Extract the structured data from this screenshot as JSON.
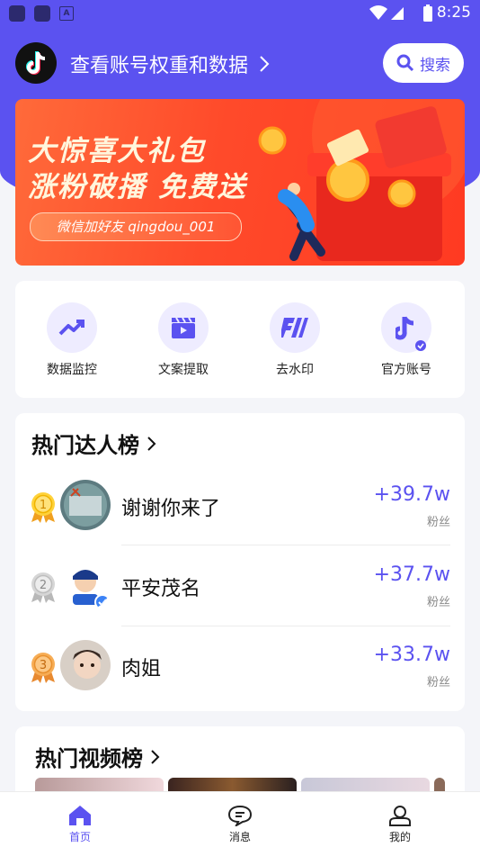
{
  "status_bar": {
    "time": "8:25"
  },
  "header": {
    "account_link": "查看账号权重和数据",
    "search_label": "搜索"
  },
  "banner": {
    "line1": "大惊喜大礼包",
    "line2": "涨粉破播 免费送",
    "wechat": "微信加好友 qingdou_001"
  },
  "tools": [
    {
      "label": "数据监控",
      "icon": "trend-up-icon"
    },
    {
      "label": "文案提取",
      "icon": "clapperboard-icon"
    },
    {
      "label": "去水印",
      "icon": "watermark-remove-icon"
    },
    {
      "label": "官方账号",
      "icon": "music-note-verified-icon"
    }
  ],
  "hot_creators": {
    "title": "热门达人榜",
    "items": [
      {
        "rank": "1",
        "name": "谢谢你来了",
        "gain": "+39.7w",
        "unit": "粉丝"
      },
      {
        "rank": "2",
        "name": "平安茂名",
        "gain": "+37.7w",
        "unit": "粉丝"
      },
      {
        "rank": "3",
        "name": "肉姐",
        "gain": "+33.7w",
        "unit": "粉丝"
      }
    ]
  },
  "hot_videos": {
    "title": "热门视频榜"
  },
  "tabbar": {
    "home": "首页",
    "messages": "消息",
    "mine": "我的"
  },
  "colors": {
    "accent": "#5b52f0",
    "banner": "#ff4a2a",
    "gold": "#f5b400",
    "silver": "#c9c9c9",
    "bronze": "#f0a040"
  }
}
